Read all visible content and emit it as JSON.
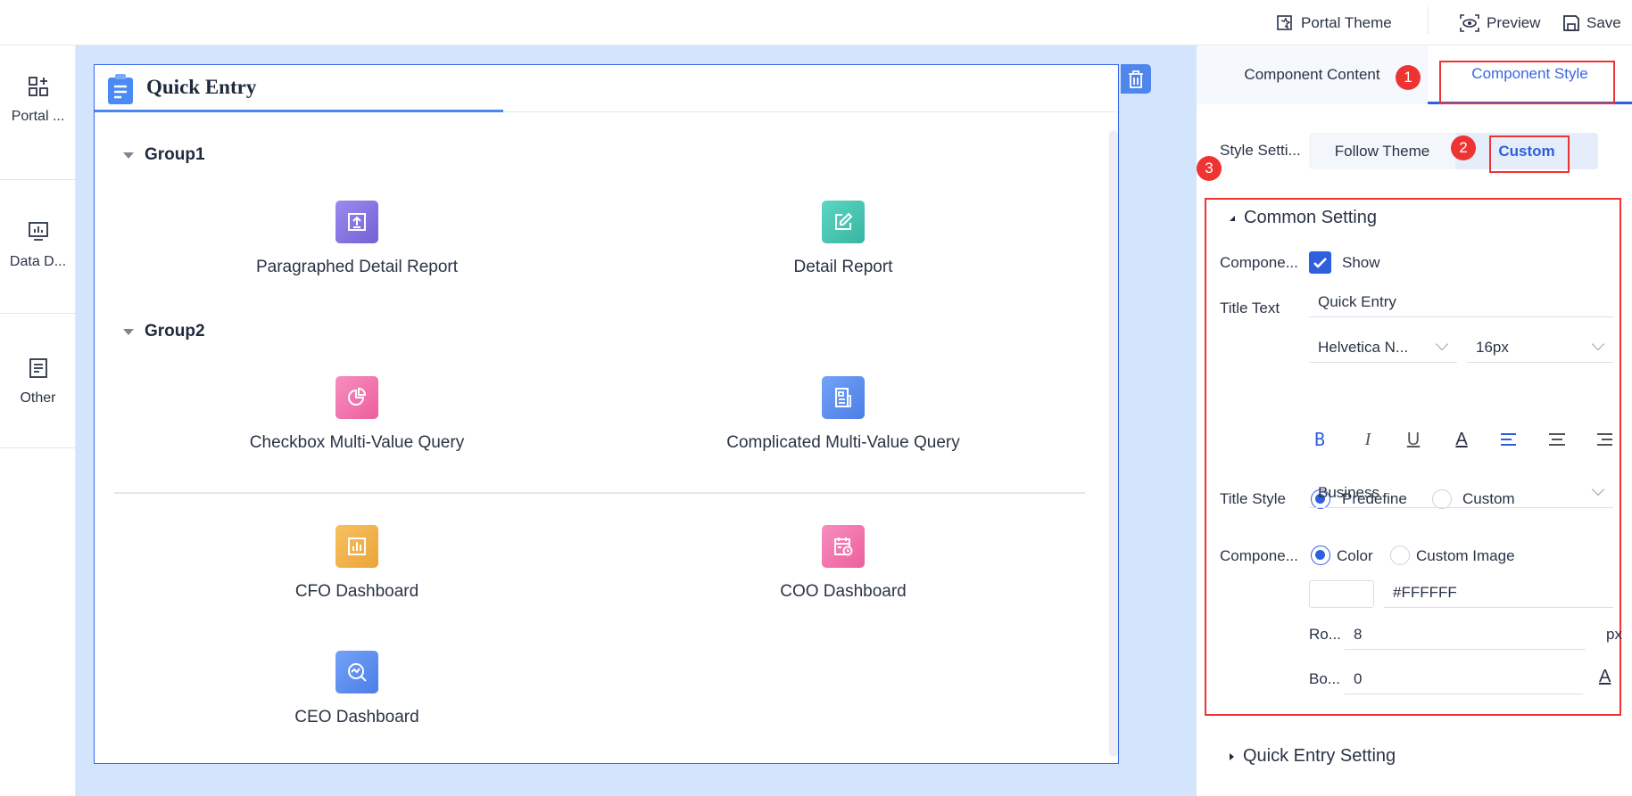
{
  "topbar": {
    "portal_theme": "Portal Theme",
    "preview": "Preview",
    "save": "Save"
  },
  "sidebar": {
    "items": [
      {
        "label": "Portal ...",
        "icon": "add-widget-icon"
      },
      {
        "label": "Data D...",
        "icon": "dashboard-chart-icon"
      },
      {
        "label": "Other",
        "icon": "document-icon"
      }
    ]
  },
  "card": {
    "title": "Quick Entry",
    "groups": [
      {
        "name": "Group1",
        "items": [
          {
            "label": "Paragraphed Detail Report",
            "color": "#8a74e0"
          },
          {
            "label": "Detail Report",
            "color": "#4cc6b4"
          }
        ]
      },
      {
        "name": "Group2",
        "items": [
          {
            "label": "Checkbox Multi-Value Query",
            "color": "#f078a8"
          },
          {
            "label": "Complicated Multi-Value Query",
            "color": "#5b8ef0"
          },
          {
            "label": "CFO Dashboard",
            "color": "#f2b046"
          },
          {
            "label": "COO Dashboard",
            "color": "#f078a8"
          },
          {
            "label": "CEO Dashboard",
            "color": "#5b8ef0"
          }
        ]
      }
    ]
  },
  "panel": {
    "tabs": [
      {
        "label": "Component Content"
      },
      {
        "label": "Component Style"
      }
    ],
    "badges": [
      "1",
      "2",
      "3"
    ],
    "style_setting": {
      "label": "Style Setti...",
      "options": [
        "Follow Theme",
        "Custom"
      ],
      "selected": "Custom"
    },
    "common": {
      "title": "Common Setting",
      "component_label": "Compone...",
      "show_label": "Show",
      "show_checked": true,
      "title_text_label": "Title Text",
      "title_text_value": "Quick Entry",
      "font_family": "Helvetica N...",
      "font_size": "16px",
      "title_style_label": "Title Style",
      "title_style_options": [
        "Predefine",
        "Custom"
      ],
      "title_style_value": "Business",
      "bg_label": "Compone...",
      "bg_options": [
        "Color",
        "Custom Image"
      ],
      "color_value": "#FFFFFF",
      "radius_label": "Ro...",
      "radius_value": "8",
      "radius_unit": "px",
      "border_label": "Bo...",
      "border_value": "0"
    },
    "quick_entry_setting": "Quick Entry Setting"
  },
  "colors": {
    "accent": "#3566e8",
    "annotation": "#ee3333"
  }
}
